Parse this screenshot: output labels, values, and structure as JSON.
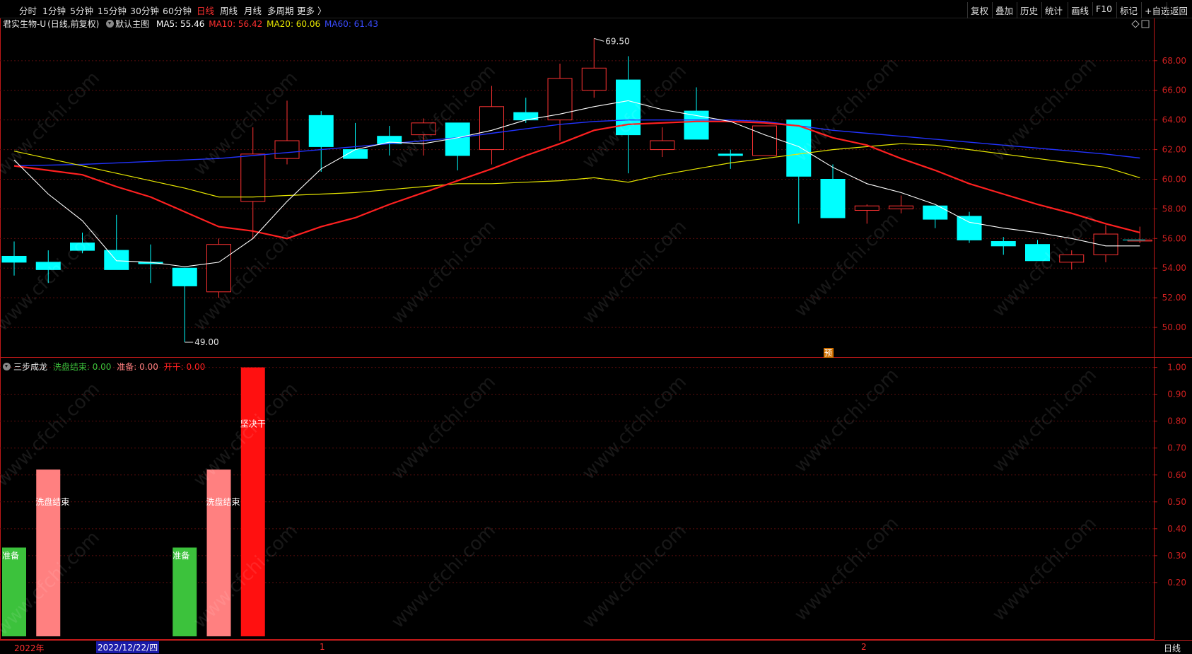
{
  "toolbar": {
    "periods": [
      "分时",
      "1分钟",
      "5分钟",
      "15分钟",
      "30分钟",
      "60分钟",
      "日线",
      "周线",
      "月线",
      "多周期",
      "更多 〉"
    ],
    "active_period": "日线",
    "tools": [
      "复权",
      "叠加",
      "历史",
      "统计",
      "画线",
      "F10",
      "标记",
      "+自选",
      "返回"
    ]
  },
  "header": {
    "stock": "君实生物-U",
    "mode": "(日线,前复权)",
    "template": "默认主图",
    "ma5": "MA5: 55.46",
    "ma10": "MA10: 56.42",
    "ma20": "MA20: 60.06",
    "ma60": "MA60: 61.43"
  },
  "indicator_header": {
    "name": "三步成龙",
    "xpjs": "洗盘结束: 0.00",
    "zb": "准备: 0.00",
    "kg": "开干: 0.00"
  },
  "annotations": {
    "high": "69.50",
    "low": "49.00",
    "pred_marker": "预"
  },
  "statusbar": {
    "year": "2022年",
    "cursor_date": "2022/12/22/四",
    "month1": "1",
    "month2": "2",
    "period": "日线"
  },
  "watermark": "www.cfchi.com",
  "colors": {
    "up": "#ff3333",
    "down": "#00ffff",
    "ma5": "#ffffff",
    "ma10": "#ff2020",
    "ma20": "#e6e600",
    "ma60": "#2233ff",
    "zb": "#3cc23c",
    "xpjs": "#ff8080",
    "kg": "#ff1010"
  },
  "chart_data": {
    "type": "candlestick",
    "y_axis_price": {
      "ticks": [
        50,
        52,
        54,
        56,
        58,
        60,
        62,
        64,
        66,
        68
      ],
      "range": [
        48.0,
        69.9
      ]
    },
    "y_axis_indicator": {
      "ticks": [
        0.2,
        0.3,
        0.4,
        0.5,
        0.6,
        0.7,
        0.8,
        0.9,
        1.0
      ],
      "range": [
        0,
        1.02
      ]
    },
    "candles": [
      {
        "o": 54.8,
        "h": 55.8,
        "l": 53.5,
        "c": 54.4
      },
      {
        "o": 54.4,
        "h": 55.2,
        "l": 53.0,
        "c": 53.9
      },
      {
        "o": 55.7,
        "h": 56.4,
        "l": 55.0,
        "c": 55.2
      },
      {
        "o": 55.2,
        "h": 57.6,
        "l": 53.9,
        "c": 53.9
      },
      {
        "o": 54.4,
        "h": 55.6,
        "l": 53.0,
        "c": 54.3
      },
      {
        "o": 54.0,
        "h": 54.0,
        "l": 49.0,
        "c": 52.8
      },
      {
        "o": 52.4,
        "h": 56.0,
        "l": 52.0,
        "c": 55.6
      },
      {
        "o": 58.5,
        "h": 63.5,
        "l": 56.0,
        "c": 61.7
      },
      {
        "o": 61.4,
        "h": 65.3,
        "l": 61.0,
        "c": 62.6
      },
      {
        "o": 64.3,
        "h": 64.6,
        "l": 60.5,
        "c": 62.2
      },
      {
        "o": 62.0,
        "h": 63.8,
        "l": 61.4,
        "c": 61.4
      },
      {
        "o": 62.9,
        "h": 63.6,
        "l": 61.6,
        "c": 62.4
      },
      {
        "o": 63.0,
        "h": 64.1,
        "l": 61.6,
        "c": 63.8
      },
      {
        "o": 63.8,
        "h": 63.8,
        "l": 60.6,
        "c": 61.6
      },
      {
        "o": 62.0,
        "h": 66.3,
        "l": 61.0,
        "c": 64.9
      },
      {
        "o": 64.5,
        "h": 65.5,
        "l": 63.8,
        "c": 64.0
      },
      {
        "o": 64.0,
        "h": 67.8,
        "l": 62.6,
        "c": 66.8
      },
      {
        "o": 66.0,
        "h": 69.5,
        "l": 65.5,
        "c": 67.5
      },
      {
        "o": 66.7,
        "h": 68.3,
        "l": 60.4,
        "c": 63.0
      },
      {
        "o": 62.0,
        "h": 63.5,
        "l": 61.5,
        "c": 62.6
      },
      {
        "o": 64.6,
        "h": 66.2,
        "l": 62.7,
        "c": 62.7
      },
      {
        "o": 61.7,
        "h": 62.0,
        "l": 60.7,
        "c": 61.6
      },
      {
        "o": 61.6,
        "h": 63.6,
        "l": 61.6,
        "c": 63.6
      },
      {
        "o": 64.0,
        "h": 64.0,
        "l": 57.0,
        "c": 60.2
      },
      {
        "o": 60.0,
        "h": 61.0,
        "l": 57.4,
        "c": 57.4
      },
      {
        "o": 57.9,
        "h": 58.3,
        "l": 57.0,
        "c": 58.2
      },
      {
        "o": 58.0,
        "h": 58.9,
        "l": 57.7,
        "c": 58.2
      },
      {
        "o": 58.2,
        "h": 58.2,
        "l": 56.7,
        "c": 57.3
      },
      {
        "o": 57.5,
        "h": 57.8,
        "l": 55.7,
        "c": 55.9
      },
      {
        "o": 55.8,
        "h": 56.1,
        "l": 54.9,
        "c": 55.5
      },
      {
        "o": 55.6,
        "h": 55.9,
        "l": 54.5,
        "c": 54.5
      },
      {
        "o": 54.4,
        "h": 55.2,
        "l": 53.9,
        "c": 54.9
      },
      {
        "o": 54.9,
        "h": 56.9,
        "l": 54.4,
        "c": 56.3
      },
      {
        "o": 55.9,
        "h": 56.8,
        "l": 55.7,
        "c": 55.9
      }
    ],
    "ma5": [
      61.3,
      59.0,
      57.2,
      54.5,
      54.4,
      54.1,
      54.4,
      56.0,
      58.5,
      60.7,
      62.0,
      62.5,
      62.4,
      62.8,
      63.3,
      64.0,
      64.4,
      64.9,
      65.3,
      64.7,
      64.3,
      63.9,
      63.0,
      62.2,
      60.8,
      59.7,
      59.1,
      58.3,
      57.1,
      56.7,
      56.4,
      56.0,
      55.5,
      55.5
    ],
    "ma10": [
      60.9,
      60.6,
      60.3,
      59.5,
      58.8,
      57.8,
      56.8,
      56.5,
      56.0,
      56.8,
      57.4,
      58.3,
      59.1,
      59.9,
      60.7,
      61.6,
      62.4,
      63.3,
      63.7,
      63.8,
      63.9,
      63.9,
      63.8,
      63.6,
      62.8,
      62.3,
      61.4,
      60.6,
      59.7,
      59.0,
      58.3,
      57.7,
      57.0,
      56.4
    ],
    "ma20": [
      61.9,
      61.4,
      60.9,
      60.4,
      59.9,
      59.4,
      58.8,
      58.8,
      58.9,
      59.0,
      59.1,
      59.3,
      59.5,
      59.7,
      59.7,
      59.8,
      59.9,
      60.1,
      59.8,
      60.3,
      60.7,
      61.1,
      61.4,
      61.7,
      62.0,
      62.2,
      62.4,
      62.3,
      62.0,
      61.7,
      61.4,
      61.1,
      60.8,
      60.1
    ],
    "ma60": [
      60.9,
      60.95,
      61.0,
      61.1,
      61.2,
      61.3,
      61.4,
      61.6,
      61.8,
      62.0,
      62.2,
      62.4,
      62.6,
      62.8,
      63.1,
      63.4,
      63.7,
      63.9,
      64.0,
      64.0,
      64.0,
      64.0,
      63.9,
      63.6,
      63.3,
      63.1,
      62.9,
      62.7,
      62.5,
      62.3,
      62.1,
      61.9,
      61.7,
      61.43
    ],
    "indicator_bars": [
      {
        "i": 0,
        "v": 0.33,
        "kind": "zb",
        "label": "准备"
      },
      {
        "i": 1,
        "v": 0.62,
        "kind": "xpjs",
        "label": "洗盘结束"
      },
      {
        "i": 5,
        "v": 0.33,
        "kind": "zb",
        "label": "准备"
      },
      {
        "i": 6,
        "v": 0.62,
        "kind": "xpjs",
        "label": "洗盘结束"
      },
      {
        "i": 7,
        "v": 1.0,
        "kind": "kg",
        "label": "坚决干"
      }
    ]
  }
}
